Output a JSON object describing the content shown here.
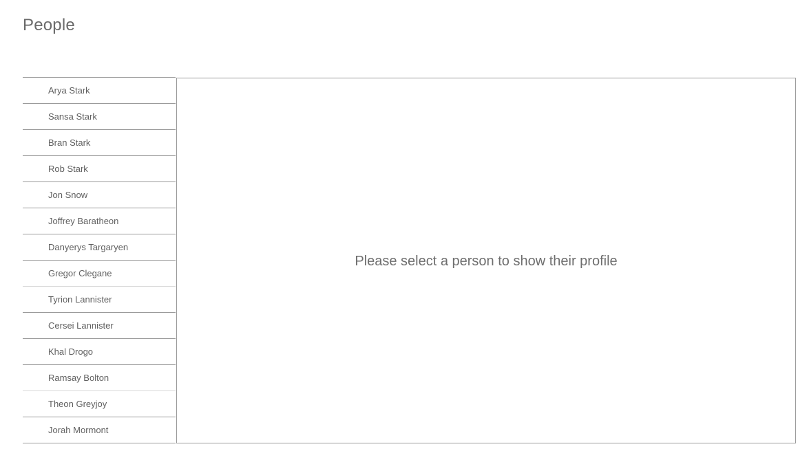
{
  "page": {
    "title": "People"
  },
  "people": [
    {
      "name": "Arya Stark"
    },
    {
      "name": "Sansa Stark"
    },
    {
      "name": "Bran Stark"
    },
    {
      "name": "Rob Stark"
    },
    {
      "name": "Jon Snow"
    },
    {
      "name": "Joffrey Baratheon"
    },
    {
      "name": "Danyerys Targaryen"
    },
    {
      "name": "Gregor Clegane"
    },
    {
      "name": "Tyrion Lannister"
    },
    {
      "name": "Cersei Lannister"
    },
    {
      "name": "Khal Drogo"
    },
    {
      "name": "Ramsay Bolton"
    },
    {
      "name": "Theon Greyjoy"
    },
    {
      "name": "Jorah Mormont"
    }
  ],
  "profile": {
    "empty_message": "Please select a person to show their profile"
  }
}
